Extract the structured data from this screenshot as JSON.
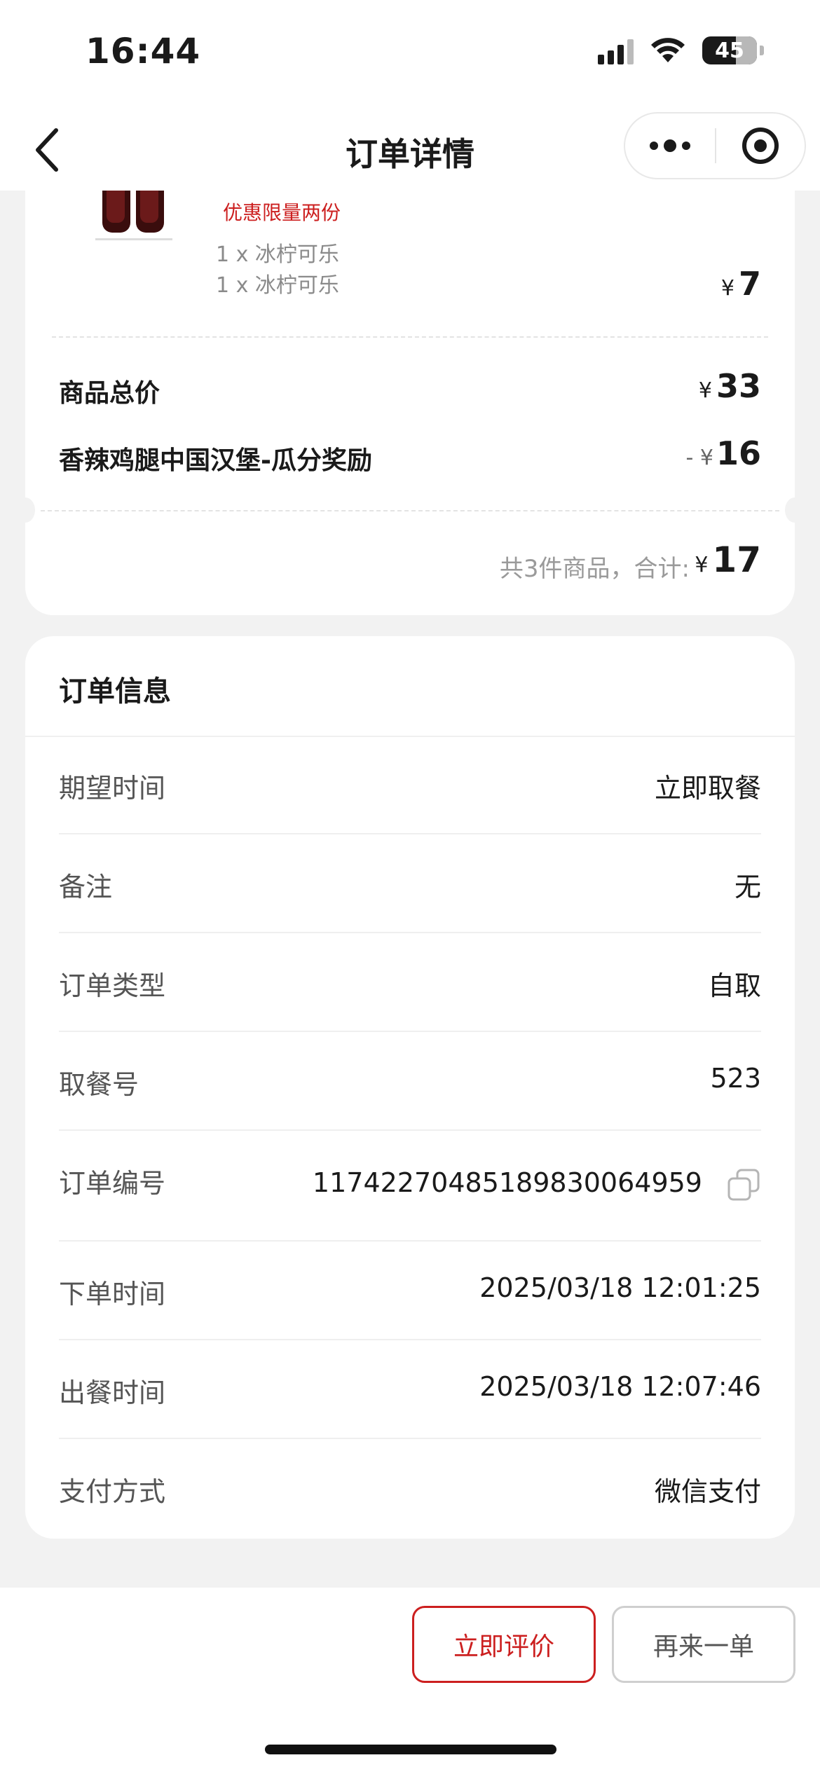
{
  "status_bar": {
    "time": "16:44",
    "battery": "45"
  },
  "nav": {
    "title": "订单详情"
  },
  "summary": {
    "promo_text": "优惠限量两份",
    "item_lines": [
      "1 x 冰柠可乐",
      "1 x 冰柠可乐"
    ],
    "item_price_symbol": "¥",
    "item_price": "7",
    "goods_total_label": "商品总价",
    "goods_total_symbol": "¥",
    "goods_total": "33",
    "discount_label": "香辣鸡腿中国汉堡-瓜分奖励",
    "discount_prefix": "- ¥",
    "discount_value": "16",
    "total_text": "共3件商品，合计:",
    "total_symbol": "¥",
    "total_value": "17"
  },
  "order_info": {
    "title": "订单信息",
    "rows": [
      {
        "label": "期望时间",
        "value": "立即取餐"
      },
      {
        "label": "备注",
        "value": "无"
      },
      {
        "label": "订单类型",
        "value": "自取"
      },
      {
        "label": "取餐号",
        "value": "523"
      },
      {
        "label": "订单编号",
        "value": "1174227048518983006495​9"
      },
      {
        "label": "下单时间",
        "value": "2025/03/18 12:01:25"
      },
      {
        "label": "出餐时间",
        "value": "2025/03/18 12:07:46"
      },
      {
        "label": "支付方式",
        "value": "微信支付"
      }
    ]
  },
  "actions": {
    "review_label": "立即评价",
    "reorder_label": "再来一单"
  },
  "colors": {
    "accent": "#cc1f1f",
    "background": "#f2f2f2"
  }
}
